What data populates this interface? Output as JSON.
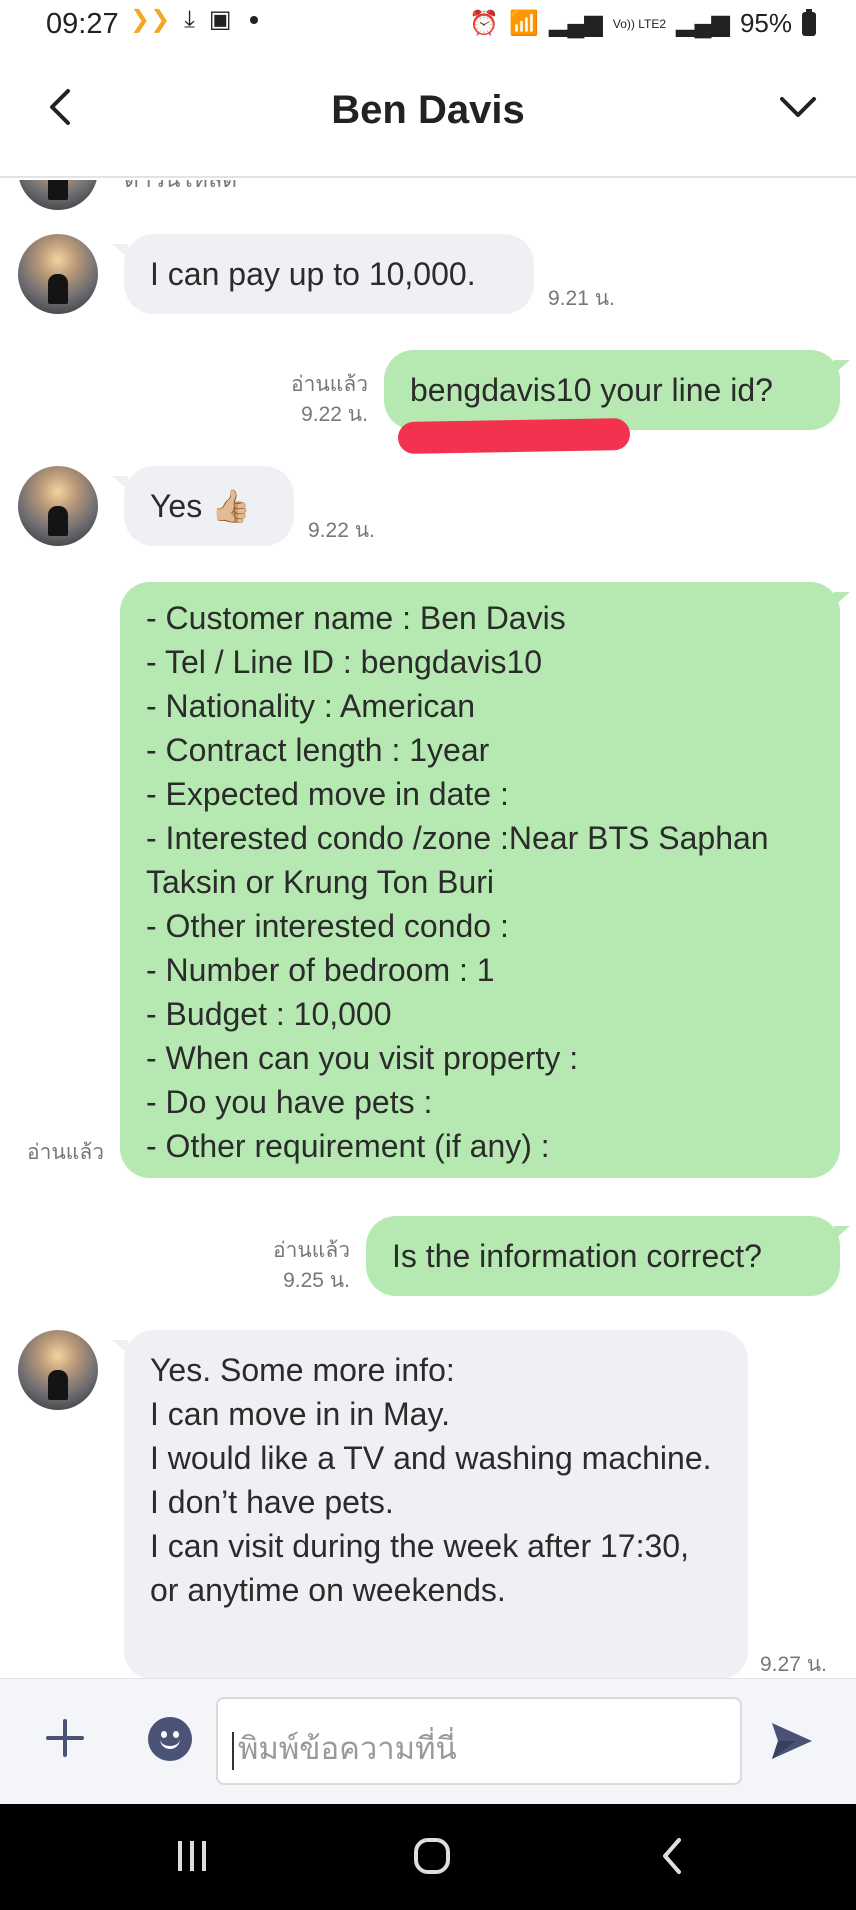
{
  "status_bar": {
    "time": "09:27",
    "battery": "95%",
    "lte_label": "Vo)) LTE2"
  },
  "header": {
    "title": "Ben Davis",
    "back_icon": "chevron-left-icon",
    "menu_icon": "chevron-down-icon"
  },
  "chat": {
    "partial_message": "ดาวน์โหลด",
    "messages": [
      {
        "direction": "in",
        "text": "I can pay up to 10,000.",
        "time": "9.21 น."
      },
      {
        "direction": "out",
        "read": "อ่านแล้ว",
        "text": "bengdavis10 your line id?",
        "time": "9.22 น."
      },
      {
        "direction": "in",
        "text": "Yes 👍🏼",
        "time": "9.22 น."
      },
      {
        "direction": "out",
        "read": "อ่านแล้ว",
        "text": "- Customer name : Ben Davis\n- Tel / Line ID : bengdavis10\n- Nationality : American\n- Contract length :  1year\n- Expected move in date :\n- Interested condo /zone :Near BTS Saphan Taksin or Krung Ton Buri\n- Other interested condo :\n- Number of bedroom  : 1\n- Budget : 10,000\n- When can you visit property :\n- Do you have pets :\n- Other requirement (if any) :"
      },
      {
        "direction": "out",
        "read": "อ่านแล้ว",
        "text": "Is the information correct?",
        "time": "9.25 น."
      },
      {
        "direction": "in",
        "text": "Yes. Some more info:\nI can move in in May.\nI would like a TV and washing machine.\nI don’t have pets.\nI can visit during the week after 17:30, or anytime on weekends.",
        "time": "9.27 น."
      }
    ]
  },
  "input": {
    "placeholder": "พิมพ์ข้อความที่นี่",
    "plus_icon": "plus-icon",
    "emoji_icon": "emoji-icon",
    "send_icon": "send-icon"
  },
  "colors": {
    "incoming_bubble": "#eff0f3",
    "outgoing_bubble": "#b6e9b2",
    "annotation_red": "#f2324e",
    "icon_dark": "#4a5276"
  }
}
